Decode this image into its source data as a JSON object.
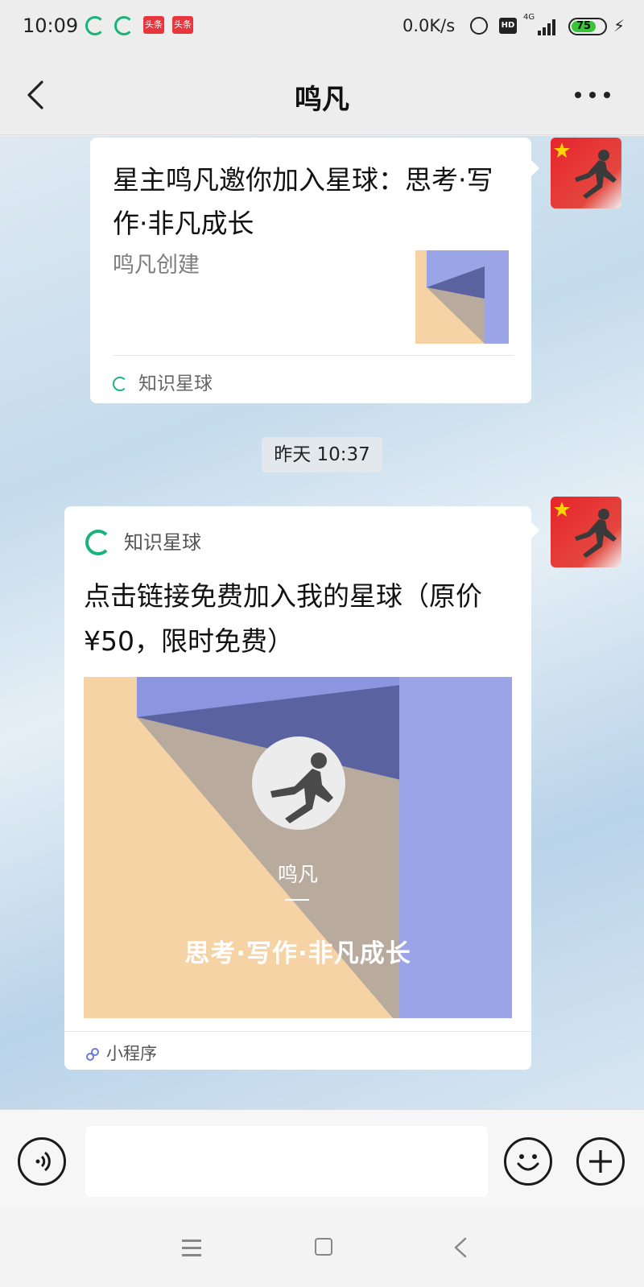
{
  "status_bar": {
    "time": "10:09",
    "speed": "0.0K/s",
    "hd": "HD",
    "network": "4G",
    "battery": "75",
    "notification_labels": [
      "头条",
      "头条"
    ]
  },
  "header": {
    "title": "鸣凡"
  },
  "messages": {
    "card1": {
      "title": "星主鸣凡邀你加入星球：思考·写作·非凡成长",
      "subtitle": "鸣凡创建",
      "source": "知识星球"
    },
    "timestamp": "昨天 10:37",
    "card2": {
      "app_name": "知识星球",
      "title": "点击链接免费加入我的星球（原价¥50，限时免费）",
      "image_name": "鸣凡",
      "image_slogan": "思考·写作·非凡成长",
      "footer": "小程序"
    }
  },
  "colors": {
    "brand_green": "#18b37a",
    "peach": "#f5d3a5",
    "taupe": "#b9aa9e",
    "indigo": "#5a62a0",
    "periwinkle": "#9aa4e6",
    "flag_red": "#e8232c"
  }
}
